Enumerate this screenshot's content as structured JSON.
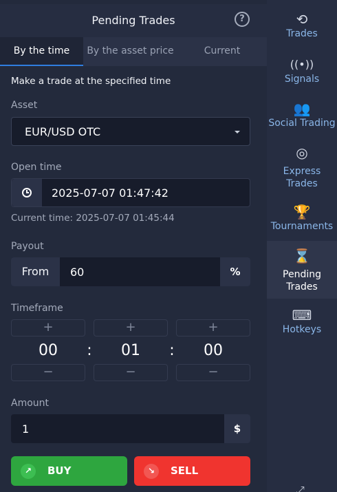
{
  "panel": {
    "title": "Pending Trades",
    "help_icon": "?"
  },
  "tabs": [
    {
      "label": "By the time",
      "active": true
    },
    {
      "label": "By the asset price",
      "active": false
    },
    {
      "label": "Current",
      "active": false
    }
  ],
  "form": {
    "description": "Make a trade at the specified time",
    "asset_label": "Asset",
    "asset_value": "EUR/USD OTC",
    "open_time_label": "Open time",
    "open_time_value": "2025-07-07 01:47:42",
    "current_time_text": "Current time: 2025-07-07 01:45:44",
    "payout_label": "Payout",
    "payout_prefix": "From",
    "payout_value": "60",
    "payout_suffix": "%",
    "timeframe_label": "Timeframe",
    "timeframe": {
      "hours": "00",
      "minutes": "01",
      "seconds": "00",
      "separator": ":",
      "plus": "+",
      "minus": "−"
    },
    "amount_label": "Amount",
    "amount_value": "1",
    "amount_suffix": "$",
    "buy_label": "BUY",
    "sell_label": "SELL"
  },
  "sidebar": {
    "items": [
      {
        "label": "Trades",
        "icon": "history-icon",
        "active": false
      },
      {
        "label": "Signals",
        "icon": "antenna-icon",
        "active": false
      },
      {
        "label": "Social Trading",
        "icon": "users-icon",
        "active": false
      },
      {
        "label": "Express Trades",
        "icon": "target-icon",
        "active": false
      },
      {
        "label": "Tournaments",
        "icon": "trophy-icon",
        "active": false
      },
      {
        "label": "Pending Trades",
        "icon": "hourglass-icon",
        "active": true
      },
      {
        "label": "Hotkeys",
        "icon": "keyboard-icon",
        "active": false
      }
    ]
  },
  "colors": {
    "accent": "#2f7ee0",
    "buy": "#2ea63f",
    "sell": "#f0342f",
    "sidebar_label": "#8ab6e8"
  }
}
